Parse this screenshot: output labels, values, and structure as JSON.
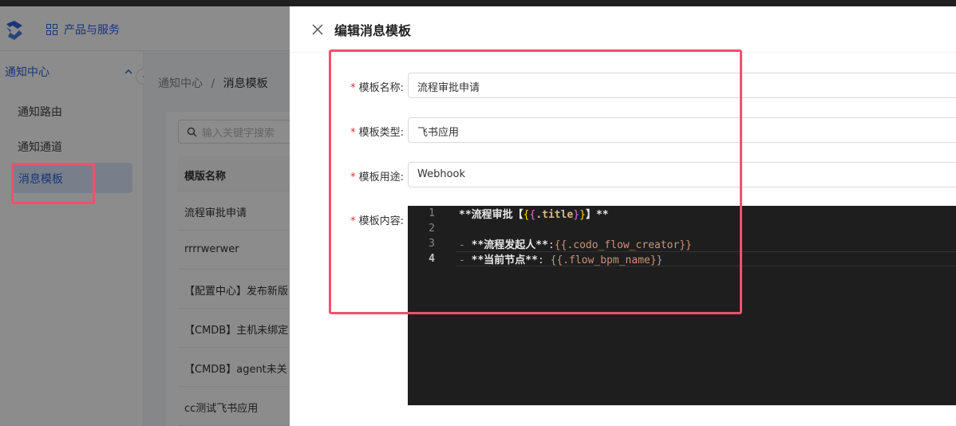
{
  "header": {
    "products_label": "产品与服务"
  },
  "sidebar": {
    "group_label": "通知中心",
    "items": [
      {
        "label": "通知路由"
      },
      {
        "label": "通知通道"
      },
      {
        "label": "消息模板"
      }
    ]
  },
  "breadcrumb": {
    "root": "通知中心",
    "separator": "/",
    "current": "消息模板"
  },
  "list": {
    "search_placeholder": "输入关键字搜索",
    "column_header": "模版名称",
    "rows": [
      "流程审批申请",
      "rrrrwerwer",
      "【配置中心】发布新版",
      "【CMDB】主机未绑定",
      "【CMDB】agent未关",
      "cc测试飞书应用"
    ]
  },
  "drawer": {
    "title": "编辑消息模板",
    "fields": {
      "name": {
        "label": "模板名称:",
        "value": "流程审批申请"
      },
      "type": {
        "label": "模板类型:",
        "value": "飞书应用"
      },
      "usage": {
        "label": "模板用途:",
        "value": "Webhook"
      },
      "content": {
        "label": "模板内容:"
      }
    },
    "editor": {
      "line_numbers": [
        "1",
        "2",
        "3",
        "4"
      ],
      "current_line": 4,
      "lines": [
        "**流程审批【{{.title}}】**",
        "",
        "- **流程发起人**:{{.codo_flow_creator}}",
        "- **当前节点**: {{.flow_bpm_name}}"
      ]
    }
  },
  "colors": {
    "accent": "#2b63d9",
    "highlight_box": "#f0506e",
    "required": "#e0343f",
    "editor_bg": "#1e1e1e"
  }
}
